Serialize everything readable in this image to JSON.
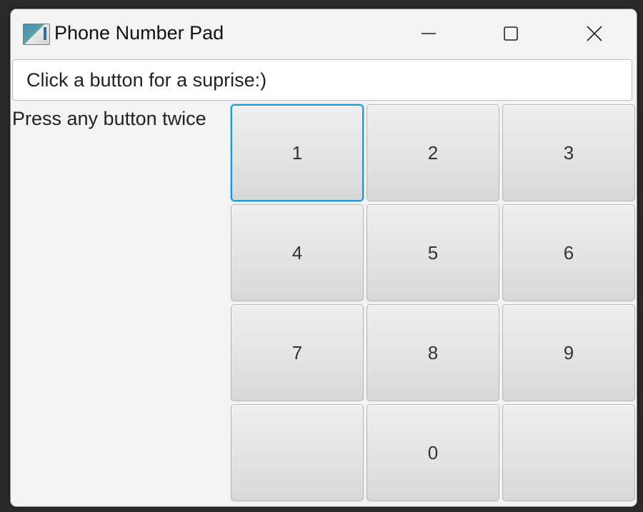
{
  "window": {
    "title": "Phone Number Pad",
    "icon": "java-app-icon"
  },
  "controls": {
    "minimize": "minimize-icon",
    "maximize": "maximize-icon",
    "close": "close-icon"
  },
  "textfield": {
    "value": "Click a button for a suprise:)"
  },
  "label": {
    "text": "Press any button twice"
  },
  "keypad": {
    "keys": [
      "1",
      "2",
      "3",
      "4",
      "5",
      "6",
      "7",
      "8",
      "9",
      "",
      "0",
      ""
    ],
    "focused_key": "1"
  },
  "colors": {
    "focus_ring": "#1d9ad6",
    "window_bg": "#f3f3f3",
    "backdrop": "#2b2b2b"
  }
}
